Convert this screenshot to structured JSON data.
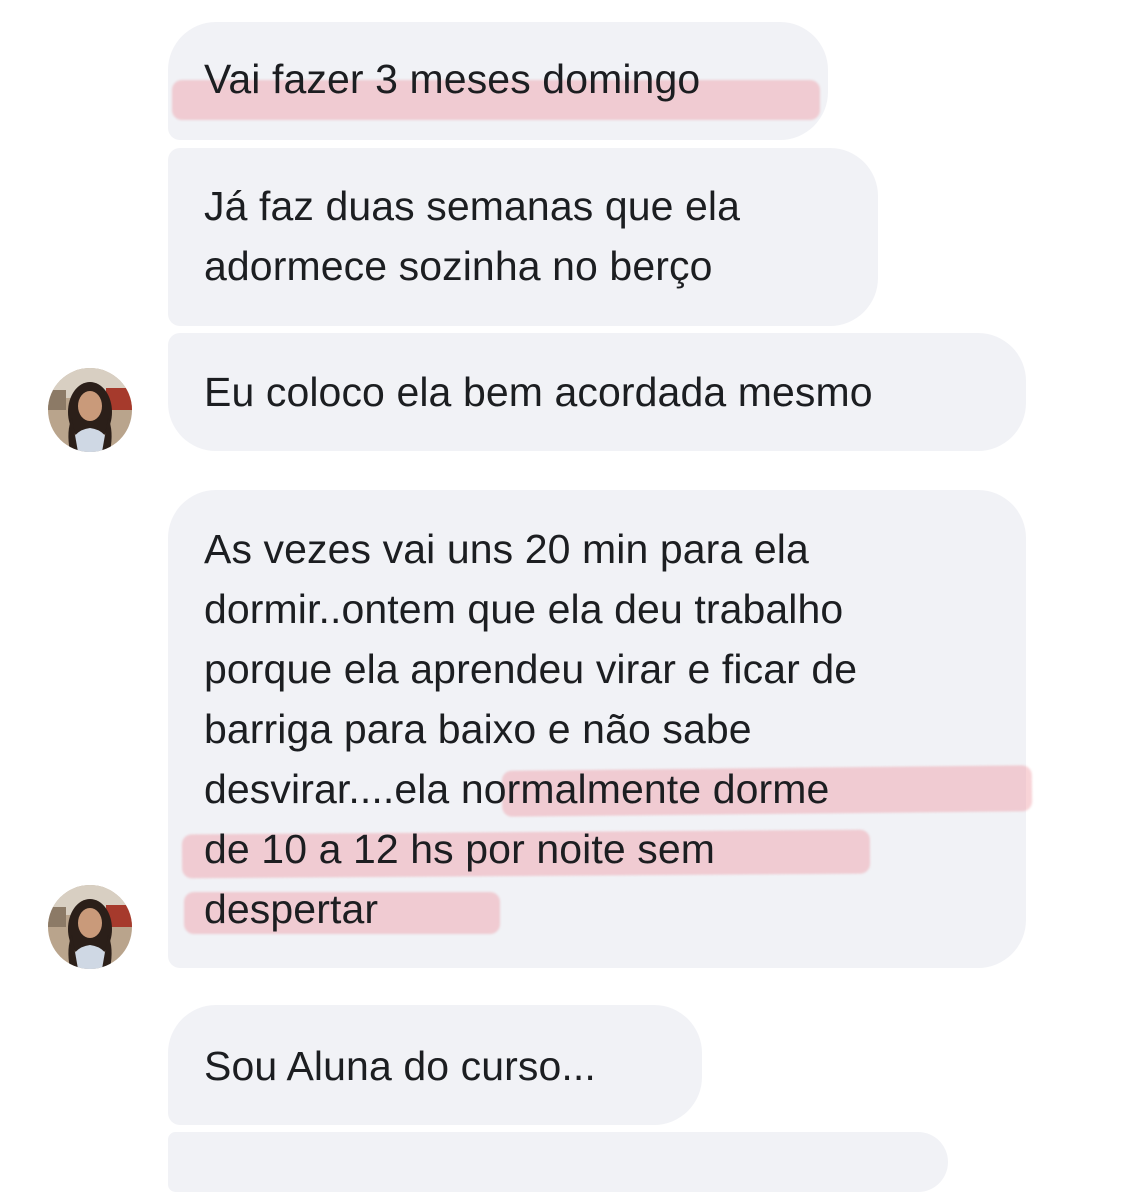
{
  "conversation": {
    "messages": [
      {
        "lines": [
          "Vai fazer 3 meses domingo"
        ]
      },
      {
        "lines": [
          "Já faz duas semanas que ela",
          "adormece sozinha no berço"
        ]
      },
      {
        "lines": [
          "Eu coloco ela bem acordada mesmo"
        ]
      },
      {
        "lines": [
          "As vezes vai uns 20 min para ela",
          "dormir..ontem que ela deu trabalho",
          "porque ela aprendeu virar e ficar de",
          "barriga para baixo e não sabe",
          "desvirar....ela normalmente dorme",
          "de 10 a 12 hs por noite sem",
          "despertar"
        ]
      },
      {
        "lines": [
          "Sou Aluna do curso..."
        ]
      }
    ]
  },
  "colors": {
    "bubble_bg": "#f1f2f6",
    "text": "#1c1e21",
    "highlight": "#ee96a0"
  }
}
